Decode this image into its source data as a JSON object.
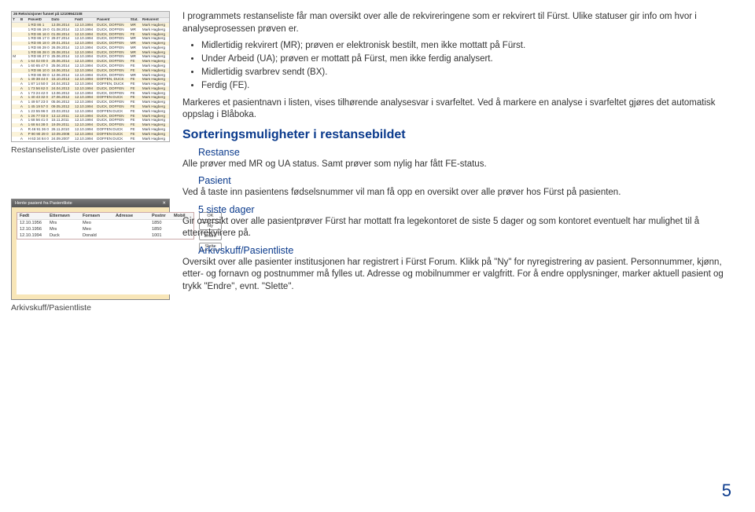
{
  "table": {
    "title": "26 Rekvisisjoner funnet på 12109942108",
    "headers": [
      "T",
      "B",
      "PrøveID",
      "Dato",
      "Født",
      "Pasient",
      "Stat.",
      "Rekvirent"
    ],
    "rows": [
      [
        "",
        "",
        "1 RD 86 1",
        "13.08.2014",
        "12.10.1994",
        "DUCK, DOFFEN",
        "MR",
        "Mark Hagberg"
      ],
      [
        "",
        "",
        "1 RD 86 19 0",
        "01.08.2014",
        "12.10.1994",
        "DUCK, DOFFEN",
        "MR",
        "Mark Hagberg"
      ],
      [
        "",
        "",
        "1 RD 86 16 0",
        "01.08.2014",
        "12.10.1994",
        "DUCK, DOFFEN",
        "FE",
        "Mark Hagberg"
      ],
      [
        "",
        "",
        "1 RD 86 17 0",
        "29.07.2014",
        "12.10.1994",
        "DUCK, DOFFEN",
        "MR",
        "Mark Hagberg"
      ],
      [
        "",
        "",
        "1 RD 86 18 0",
        "29.01.2014",
        "12.10.1994",
        "DUCK, DOFFEN",
        "MR",
        "Mark Hagberg"
      ],
      [
        "",
        "",
        "1 RD 86 29 0",
        "26.09.2014",
        "12.10.1994",
        "DUCK, DOFFEN",
        "MR",
        "Mark Hagberg"
      ],
      [
        "",
        "",
        "1 RD 86 28 0",
        "25.08.2014",
        "12.10.1994",
        "DUCK, DOFFEN",
        "MR",
        "Mark Hagberg"
      ],
      [
        "M",
        "",
        "1 RD 86 27 0",
        "25.06.2014",
        "12.10.1994",
        "DUCK, DOFFEN",
        "MR",
        "Mark Hagberg"
      ],
      [
        "",
        "A",
        "1 64 02 00 0",
        "25.06.2014",
        "12.10.1994",
        "DUCK, DOFFEN",
        "FE",
        "Mark Hagberg"
      ],
      [
        "",
        "A",
        "1 60 65 47 0",
        "25.06.2014",
        "12.10.1994",
        "DUCK, DOFFEN",
        "FE",
        "Mark Hagberg"
      ],
      [
        "",
        "",
        "1 RD 86 10 0",
        "16.06.2014",
        "12.10.1994",
        "DUCK, DOFFEN",
        "FE",
        "Mark Hagberg"
      ],
      [
        "",
        "",
        "1 RD 86 08 0",
        "12.06.2014",
        "12.10.1994",
        "DUCK, DOFFEN",
        "MR",
        "Mark Hagberg"
      ],
      [
        "",
        "A",
        "1 49 38 44 0",
        "15.10.2013",
        "12.10.1994",
        "DOFFEN, DUCK",
        "FE",
        "Mark Hagberg"
      ],
      [
        "",
        "A",
        "1 87 14 50 0",
        "24.04.2013",
        "12.10.1994",
        "DOFFEN, DUCK",
        "FE",
        "Mark Hagberg"
      ],
      [
        "",
        "A",
        "1 73 56 62 0",
        "24.04.2013",
        "12.10.1994",
        "DUCK, DOFFEN",
        "FE",
        "Mark Hagberg"
      ],
      [
        "",
        "A",
        "1 73 24 42 0",
        "13.06.2012",
        "12.10.1994",
        "DUCK, DOFFEN",
        "FE",
        "Mark Hagberg"
      ],
      [
        "",
        "A",
        "1 40 43 32 0",
        "27.06.2012",
        "12.10.1994",
        "DOFFEN DUCK",
        "FE",
        "Mark Hagberg"
      ],
      [
        "",
        "A",
        "1 49 57 23 0",
        "05.06.2012",
        "12.10.1994",
        "DUCK, DOFFEN",
        "FE",
        "Mark Hagberg"
      ],
      [
        "",
        "A",
        "1 45 19 57 0",
        "09.05.2012",
        "12.10.1994",
        "DUCK, DOFFEN",
        "FE",
        "Mark Hagberg"
      ],
      [
        "",
        "A",
        "1 23 55 96 0",
        "23.03.2012",
        "12.10.1994",
        "DOFFEN DUCK",
        "FE",
        "Mark Hagberg"
      ],
      [
        "",
        "A",
        "1 26 77 03 0",
        "13.12.2011",
        "12.10.1994",
        "DUCK, DOFFEN",
        "FE",
        "Mark Hagberg"
      ],
      [
        "",
        "A",
        "1 68 56 41 0",
        "15.11.2011",
        "12.10.1994",
        "DUCK, DOFFEN",
        "FE",
        "Mark Hagberg"
      ],
      [
        "",
        "A",
        "1 68 64 38 0",
        "19.09.2011",
        "12.10.1994",
        "DUCK, DOFFEN",
        "FE",
        "Mark Hagberg"
      ],
      [
        "",
        "A",
        "R 46 91 36 0",
        "26.11.2010",
        "12.10.1994",
        "DOFFEN DUCK",
        "FE",
        "Mark Hagberg"
      ],
      [
        "",
        "A",
        "P 90 90 29 0",
        "10.09.2008",
        "12.10.1994",
        "DOFFEN DUCK",
        "FE",
        "Mark Hagberg"
      ],
      [
        "",
        "A",
        "H 63 34 84 0",
        "24.09.2007",
        "12.10.1994",
        "DOFFEN DUCK",
        "FE",
        "Mark Hagberg"
      ]
    ]
  },
  "captions": {
    "table_caption": "Restanseliste/Liste over pasienter",
    "dialog_caption": "Arkivskuff/Pasientliste"
  },
  "dialog": {
    "title": "Hente pasient fra Pasientliste",
    "headers": [
      "Født",
      "Etternavn",
      "Fornavn",
      "Adresse",
      "Postnr",
      "Mobil"
    ],
    "rows": [
      [
        "12.10.1956",
        "Mrs",
        "Meo",
        "",
        "1850",
        ""
      ],
      [
        "12.10.1956",
        "Mrs",
        "Meo",
        "",
        "1850",
        ""
      ],
      [
        "12.10.1994",
        "Duck",
        "Donald",
        "",
        "1001",
        ""
      ]
    ],
    "buttons": [
      "OK",
      "Ny",
      "Endre",
      "Slette"
    ]
  },
  "text": {
    "intro1": "I programmets restanseliste får man oversikt over alle de rekvireringene som er rekvirert til Fürst. Ulike statuser gir info om hvor i analyseprosessen prøven er.",
    "b1": "Midlertidig rekvirert (MR); prøven er elektronisk bestilt, men ikke mottatt på Fürst.",
    "b2": "Under Arbeid (UA); prøven er mottatt på Fürst, men ikke ferdig analysert.",
    "b3": "Midlertidig svarbrev sendt (BX).",
    "b4": "Ferdig (FE).",
    "intro2": "Markeres et pasientnavn i listen, vises tilhørende analysesvar i svarfeltet. Ved å markere en analyse i svarfeltet gjøres det automatisk oppslag i Blåboka.",
    "h_sort": "Sorteringsmuligheter i restansebildet",
    "h_rest": "Restanse",
    "p_rest": "Alle prøver med MR og UA status. Samt prøver som nylig har fått FE-status.",
    "h_pas": "Pasient",
    "p_pas": "Ved å taste inn pasientens fødselsnummer vil man få opp en oversikt over alle prøver hos Fürst på pasienten.",
    "h_5": "5 siste dager",
    "p_5": "Gir oversikt over alle pasientprøver Fürst har mottatt fra legekontoret de siste 5 dager og som kontoret eventuelt har mulighet til å etterrekvirere på.",
    "h_ark": "Arkivskuff/Pasientliste",
    "p_ark": "Oversikt over alle pasienter institusjonen har registrert i Fürst Forum. Klikk på \"Ny\" for nyregistrering av pasient. Personnummer, kjønn, etter- og fornavn og postnummer må fylles ut. Adresse og mobilnummer er valgfritt. For å endre opplysninger, marker aktuell pasient og trykk \"Endre\", evnt. \"Slette\"."
  },
  "pagenum": "5"
}
